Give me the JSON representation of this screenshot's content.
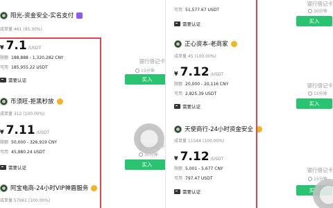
{
  "left": {
    "top_card": {
      "merchant": "阳光-资金安全-实名支付",
      "stats": "成单量 461 (95.30%)"
    },
    "card1": {
      "currency": "¥",
      "price": "7.1",
      "unit": "/USDT",
      "limit_label": "限额",
      "limit": "188,888 - 1,320,282 CNY",
      "available_label": "可用",
      "available": "185,955.22 USDT",
      "verify": "需要认证",
      "payment": "银行借记卡",
      "time": "15分钟",
      "buy": "买入"
    },
    "merchant2": {
      "merchant": "币须旺-拒黑秒放",
      "stats": "成单量 312 (100.00%)"
    },
    "card2": {
      "currency": "¥",
      "price": "7.11",
      "unit": "/USDT",
      "limit_label": "限额",
      "limit": "50,000 - 326,919 CNY",
      "available_label": "可用",
      "available": "45,980.24 USDT",
      "verify": "需要认证",
      "payment": "银行借记卡",
      "time": "30分钟",
      "buy": "买入"
    },
    "merchant3": {
      "merchant": "阿宝电商-24小时VIP神盾服务",
      "stats": "成单量 57061 (100.00%)"
    }
  },
  "right": {
    "card0": {
      "available_label": "可用",
      "available": "51,577.67 USDT",
      "verify": "需要认证",
      "payment": "银行借记卡",
      "time": "30分钟",
      "buy": "买入"
    },
    "merchant1": {
      "merchant": "正心资本-老商家",
      "stats": "成单量 45 (100.00%)"
    },
    "card1": {
      "currency": "¥",
      "price": "7.12",
      "unit": "/USDT",
      "limit_label": "限额",
      "limit": "20,000 - 20,116 CNY",
      "available_label": "可用",
      "available": "2,825.39 USDT",
      "verify": "需要认证",
      "payment": "银行借记卡",
      "time": "15分钟",
      "buy": "买入"
    },
    "merchant2": {
      "merchant": "天使商行-24小时资金安全",
      "stats": "成单量 11544 (100.00%)"
    },
    "card2": {
      "currency": "¥",
      "price": "7.12",
      "unit": "/USDT",
      "limit_label": "限额",
      "limit": "5,001 - 5,677 CNY",
      "available_label": "可用",
      "available": "797.47 USDT",
      "verify": "需要认证",
      "payment": "银行借记卡",
      "time": "15分钟",
      "buy": "买入"
    }
  },
  "colors": {
    "buy_button": "#2ac372",
    "highlight": "#e8404a",
    "muted_text": "#8b8b8b"
  }
}
